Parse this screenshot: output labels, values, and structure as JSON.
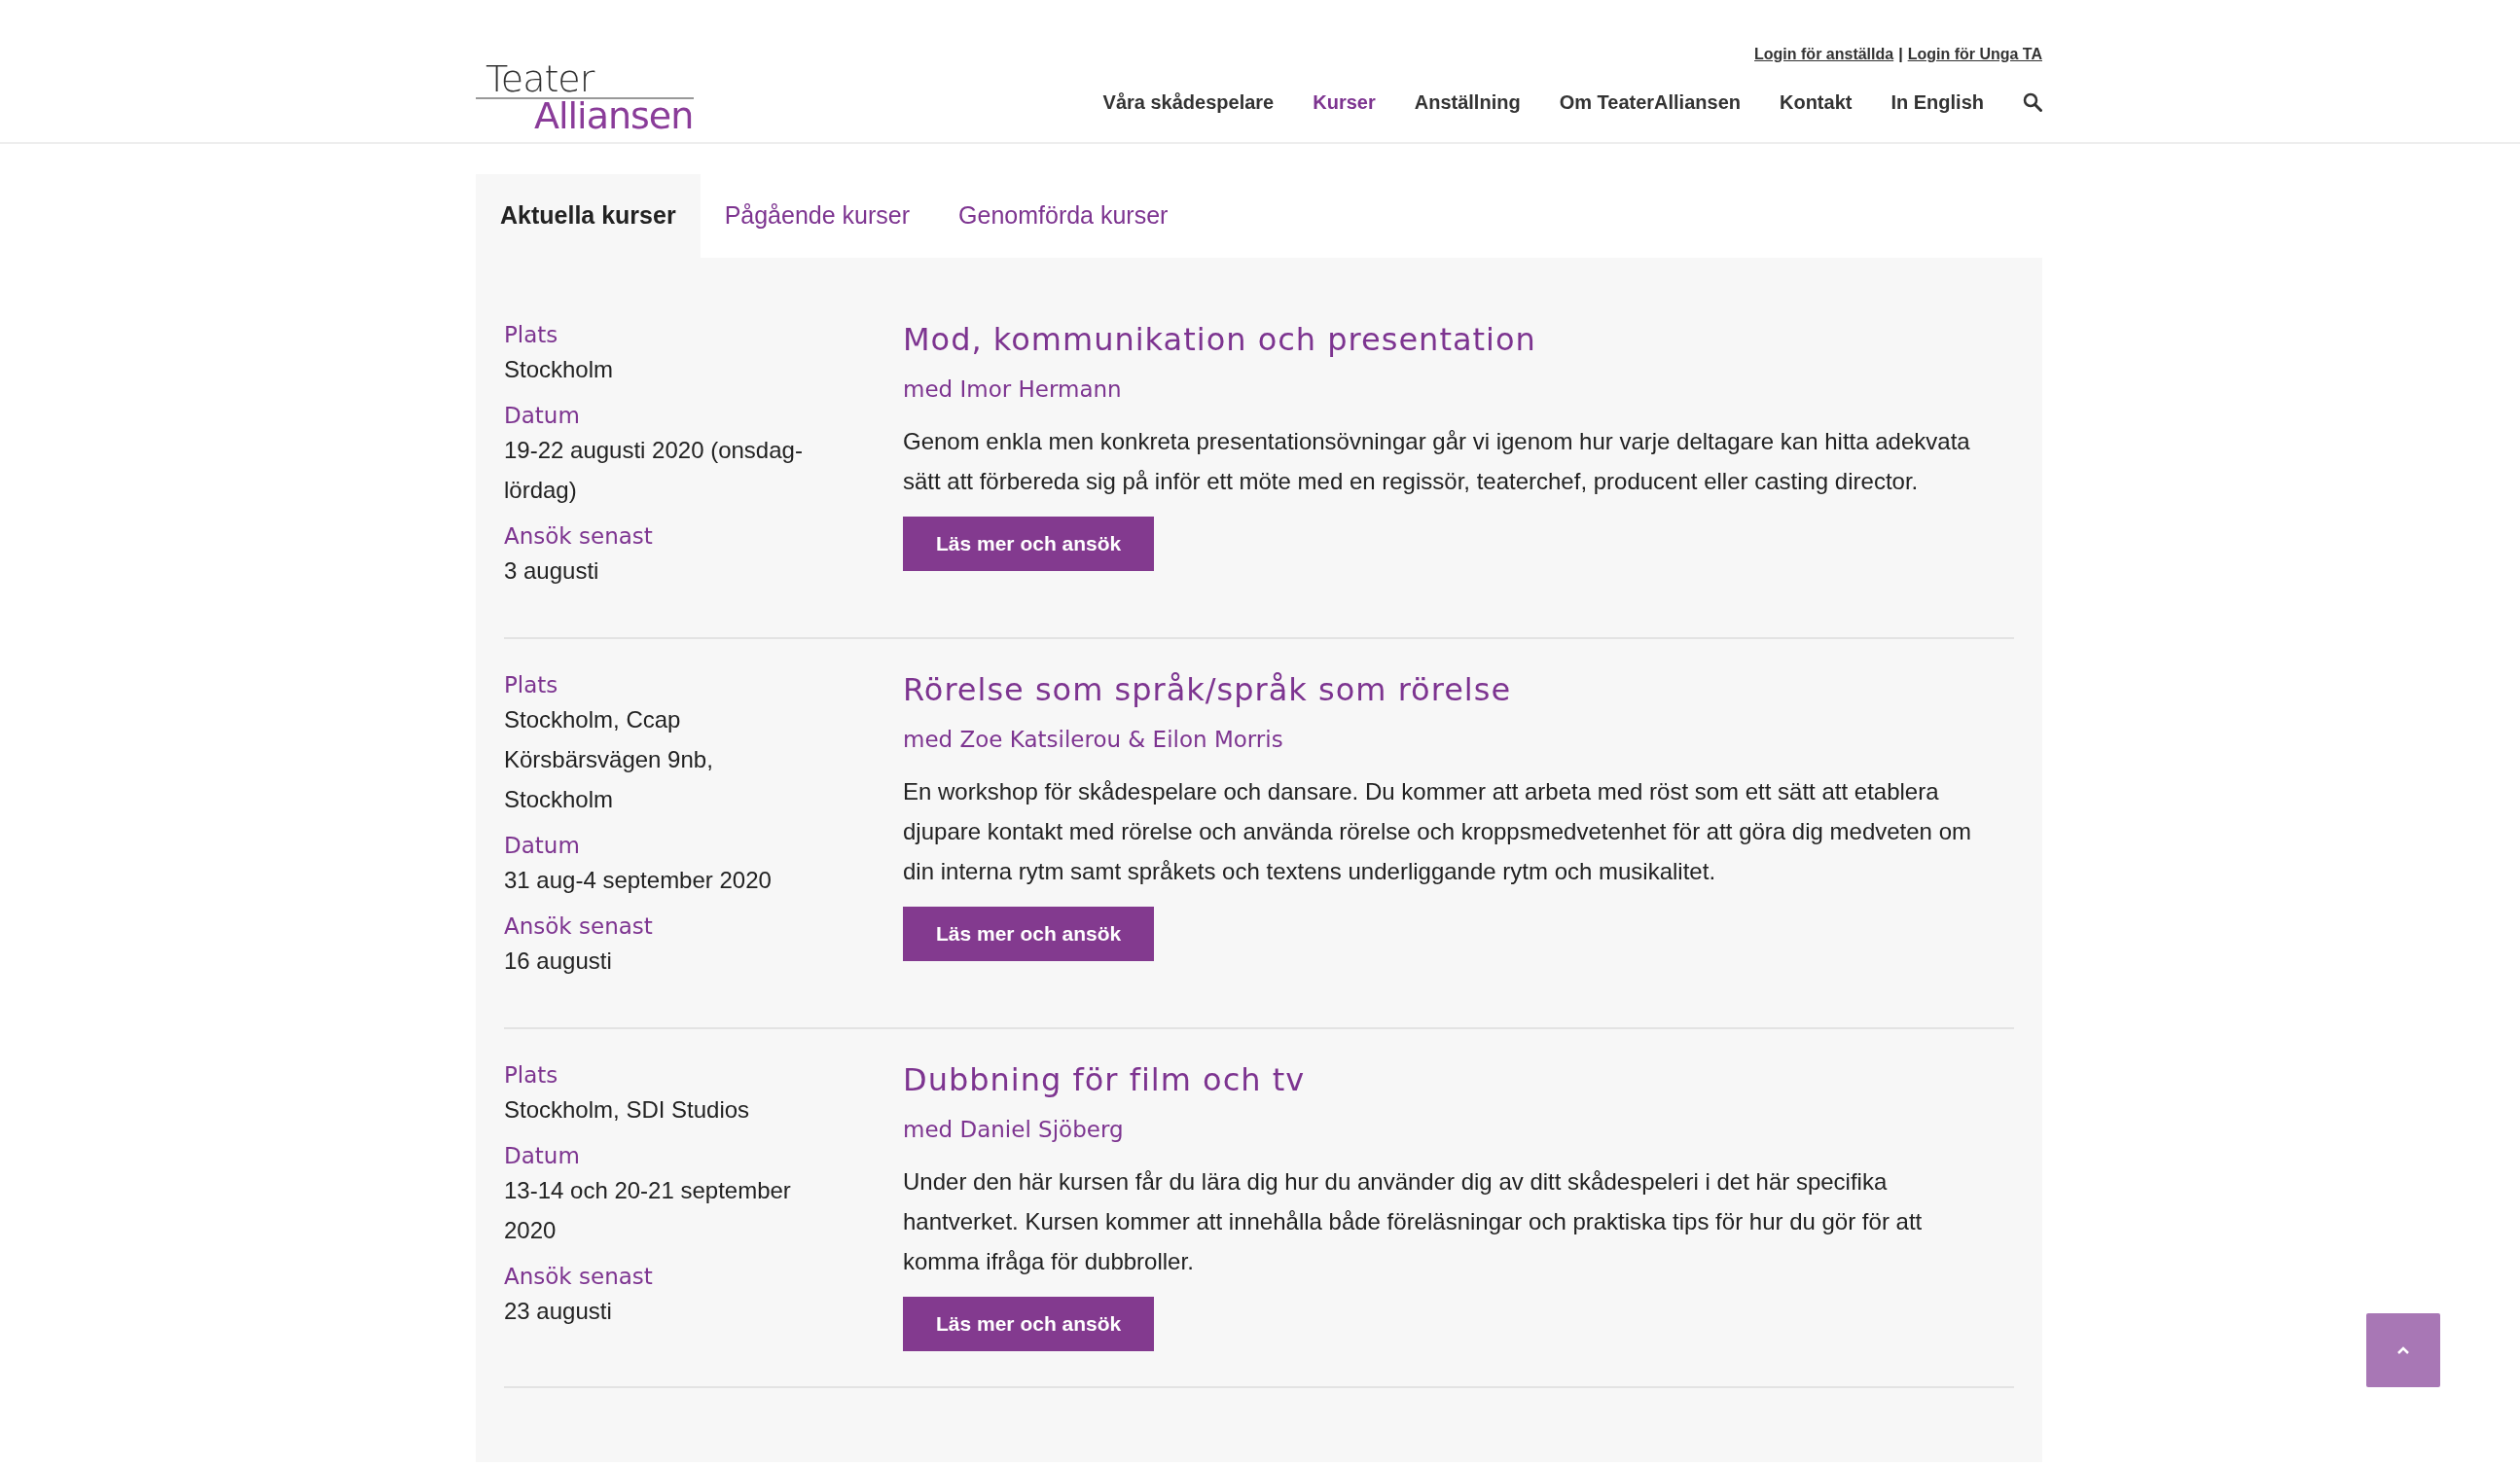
{
  "logo": {
    "line_1": "Teater",
    "line_2": "Alliansen"
  },
  "top_links": [
    "Login för anställda",
    "|",
    "Login för Unga TA"
  ],
  "nav": [
    {
      "label": "Våra skådespelare",
      "selected": false
    },
    {
      "label": "Kurser",
      "selected": true
    },
    {
      "label": "Anställning",
      "selected": false
    },
    {
      "label": "Om TeaterAlliansen",
      "selected": false
    },
    {
      "label": "Kontakt",
      "selected": false
    },
    {
      "label": "In English",
      "selected": false
    }
  ],
  "tabs": [
    {
      "label": "Aktuella kurser",
      "selected": true
    },
    {
      "label": "Pågående kurser",
      "selected": false
    },
    {
      "label": "Genomförda kurser",
      "selected": false
    }
  ],
  "courses": [
    {
      "details": [
        {
          "label": "Plats",
          "value": "Stockholm"
        },
        {
          "label": "Datum",
          "value": "19-22 augusti 2020 (onsdag-lördag)"
        },
        {
          "label": "Ansök senast",
          "value": "3 augusti"
        }
      ],
      "title": "Mod, kommunikation och presentation",
      "teacher": "med Imor Hermann",
      "description": "Genom enkla men konkreta presentationsövningar går vi igenom hur varje deltagare kan hitta adekvata sätt att förbereda sig på inför ett möte med en regissör, teaterchef, producent eller casting director.",
      "button": "Läs mer och ansök"
    },
    {
      "details": [
        {
          "label": "Plats",
          "value": "Stockholm, Ccap Körsbärsvägen 9nb, Stockholm"
        },
        {
          "label": "Datum",
          "value": "31 aug-4 september 2020"
        },
        {
          "label": "Ansök senast",
          "value": "16 augusti"
        }
      ],
      "title": "Rörelse som språk/språk som rörelse",
      "teacher": "med Zoe Katsilerou & Eilon Morris",
      "description": "En workshop för skådespelare och dansare. Du kommer att arbeta med röst som ett sätt att etablera djupare kontakt med rörelse och använda rörelse och kroppsmedvetenhet för att göra dig medveten om din interna rytm samt språkets och textens underliggande rytm och musikalitet.",
      "button": "Läs mer och ansök"
    },
    {
      "details": [
        {
          "label": "Plats",
          "value": "Stockholm, SDI Studios"
        },
        {
          "label": "Datum",
          "value": "13-14 och 20-21 september 2020"
        },
        {
          "label": "Ansök senast",
          "value": "23 augusti"
        }
      ],
      "title": "Dubbning för film och tv",
      "teacher": "med Daniel Sjöberg",
      "description": "Under den här kursen får du lära dig hur du använder dig av ditt skådespeleri i det här specifika hantverket. Kursen kommer att innehålla både föreläsningar och praktiska tips för hur du gör för att komma ifråga för dubbroller.",
      "button": "Läs mer och ansök"
    }
  ]
}
